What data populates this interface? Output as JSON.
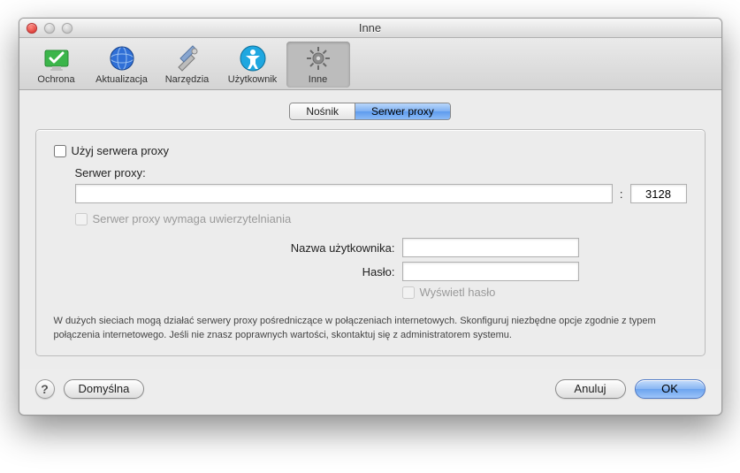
{
  "window": {
    "title": "Inne"
  },
  "toolbar": {
    "items": [
      {
        "label": "Ochrona"
      },
      {
        "label": "Aktualizacja"
      },
      {
        "label": "Narzędzia"
      },
      {
        "label": "Użytkownik"
      },
      {
        "label": "Inne"
      }
    ]
  },
  "tabs": {
    "nosnik": "Nośnik",
    "proxy": "Serwer proxy"
  },
  "form": {
    "use_proxy_label": "Użyj serwera proxy",
    "server_label": "Serwer proxy:",
    "server_value": "",
    "port_value": "3128",
    "auth_required_label": "Serwer proxy wymaga uwierzytelniania",
    "username_label": "Nazwa użytkownika:",
    "password_label": "Hasło:",
    "username_value": "",
    "password_value": "",
    "show_password_label": "Wyświetl hasło",
    "help_text": "W dużych sieciach mogą działać serwery proxy pośredniczące w połączeniach internetowych. Skonfiguruj niezbędne opcje zgodnie z typem połączenia internetowego. Jeśli nie znasz poprawnych wartości, skontaktuj się z administratorem systemu."
  },
  "buttons": {
    "help": "?",
    "default": "Domyślna",
    "cancel": "Anuluj",
    "ok": "OK"
  },
  "colon": ":"
}
